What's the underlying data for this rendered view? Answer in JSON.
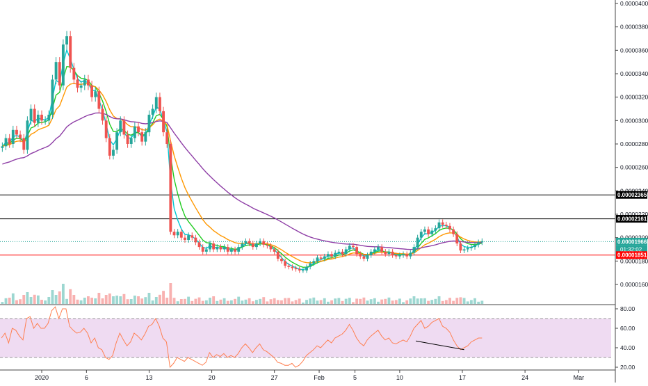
{
  "chart_data": [
    {
      "type": "candlestick",
      "title": "",
      "y_axis": {
        "position": "right",
        "range": [
          1.5e-05,
          4e-05
        ],
        "ticks": [
          "0.00001600",
          "0.00001800",
          "0.00002000",
          "0.00002200",
          "0.00002400",
          "0.00002600",
          "0.00002800",
          "0.00003000",
          "0.00003200",
          "0.00003400",
          "0.00003600",
          "0.00003800",
          "0.00004000"
        ]
      },
      "x_axis": {
        "ticks": [
          {
            "label": "2020",
            "day": 0
          },
          {
            "label": "6",
            "day": 5
          },
          {
            "label": "13",
            "day": 12
          },
          {
            "label": "20",
            "day": 19
          },
          {
            "label": "27",
            "day": 26
          },
          {
            "label": "Feb",
            "day": 31
          },
          {
            "label": "5",
            "day": 35
          },
          {
            "label": "10",
            "day": 40
          },
          {
            "label": "17",
            "day": 47
          },
          {
            "label": "24",
            "day": 54
          },
          {
            "label": "Mar",
            "day": 60
          }
        ],
        "start_day": -4.5,
        "end_day": 65
      },
      "price_lines": [
        {
          "label": "0.00002365",
          "value": 2.365e-05,
          "color": "#000000",
          "style": "solid"
        },
        {
          "label": "0.00002161",
          "value": 2.161e-05,
          "color": "#000000",
          "style": "solid"
        },
        {
          "label": "0.00001966",
          "value": 1.966e-05,
          "color": "#26a69a",
          "style": "dotted"
        },
        {
          "label": "0.00001851",
          "value": 1.851e-05,
          "color": "#ff0000",
          "style": "solid"
        }
      ],
      "countdown": "01:32:02",
      "series": [
        {
          "name": "price",
          "kind": "candles",
          "up_color": "#26a69a",
          "down_color": "#ef5350",
          "points": [
            [
              -4.4,
              2.78e-05
            ],
            [
              -4.0,
              2.85e-05
            ],
            [
              -3.6,
              2.8e-05
            ],
            [
              -3.2,
              2.92e-05
            ],
            [
              -2.8,
              2.88e-05
            ],
            [
              -2.4,
              2.85e-05
            ],
            [
              -2.0,
              2.75e-05
            ],
            [
              -1.6,
              3e-05
            ],
            [
              -1.2,
              3.1e-05
            ],
            [
              -0.8,
              2.98e-05
            ],
            [
              -0.4,
              3.05e-05
            ],
            [
              0.0,
              3e-05
            ],
            [
              0.4,
              3e-05
            ],
            [
              0.8,
              3.05e-05
            ],
            [
              1.2,
              3.35e-05
            ],
            [
              1.6,
              3.5e-05
            ],
            [
              2.0,
              3.3e-05
            ],
            [
              2.4,
              3.65e-05
            ],
            [
              2.8,
              3.72e-05
            ],
            [
              3.2,
              3.45e-05
            ],
            [
              3.6,
              3.35e-05
            ],
            [
              4.0,
              3.28e-05
            ],
            [
              4.4,
              3.3e-05
            ],
            [
              4.8,
              3.35e-05
            ],
            [
              5.2,
              3.3e-05
            ],
            [
              5.6,
              3.2e-05
            ],
            [
              6.0,
              3.25e-05
            ],
            [
              6.4,
              3.1e-05
            ],
            [
              6.8,
              3e-05
            ],
            [
              7.2,
              2.85e-05
            ],
            [
              7.6,
              2.7e-05
            ],
            [
              8.0,
              2.75e-05
            ],
            [
              8.4,
              2.9e-05
            ],
            [
              8.8,
              3e-05
            ],
            [
              9.2,
              2.88e-05
            ],
            [
              9.6,
              2.8e-05
            ],
            [
              10.0,
              2.85e-05
            ],
            [
              10.4,
              2.95e-05
            ],
            [
              10.8,
              2.9e-05
            ],
            [
              11.2,
              2.82e-05
            ],
            [
              11.6,
              2.9e-05
            ],
            [
              12.0,
              3.05e-05
            ],
            [
              12.4,
              3.1e-05
            ],
            [
              12.8,
              3.2e-05
            ],
            [
              13.2,
              3.08e-05
            ],
            [
              13.6,
              2.9e-05
            ],
            [
              14.0,
              2.8e-05
            ],
            [
              14.4,
              2.05e-05
            ],
            [
              14.8,
              2.02e-05
            ],
            [
              15.2,
              2.05e-05
            ],
            [
              15.6,
              2e-05
            ],
            [
              16.0,
              1.98e-05
            ],
            [
              16.4,
              2.02e-05
            ],
            [
              16.8,
              2e-05
            ],
            [
              17.2,
              1.96e-05
            ],
            [
              17.6,
              1.92e-05
            ],
            [
              18.0,
              1.88e-05
            ],
            [
              18.4,
              1.9e-05
            ],
            [
              18.8,
              1.95e-05
            ],
            [
              19.2,
              1.9e-05
            ],
            [
              19.6,
              1.92e-05
            ],
            [
              20.0,
              1.9e-05
            ],
            [
              20.4,
              1.92e-05
            ],
            [
              20.8,
              1.88e-05
            ],
            [
              21.2,
              1.9e-05
            ],
            [
              21.6,
              1.88e-05
            ],
            [
              22.0,
              1.92e-05
            ],
            [
              22.4,
              1.95e-05
            ],
            [
              22.8,
              1.97e-05
            ],
            [
              23.2,
              1.95e-05
            ],
            [
              23.6,
              1.92e-05
            ],
            [
              24.0,
              1.95e-05
            ],
            [
              24.4,
              1.97e-05
            ],
            [
              24.8,
              1.94e-05
            ],
            [
              25.2,
              1.93e-05
            ],
            [
              25.6,
              1.9e-05
            ],
            [
              26.0,
              1.88e-05
            ],
            [
              26.4,
              1.82e-05
            ],
            [
              26.8,
              1.8e-05
            ],
            [
              27.2,
              1.76e-05
            ],
            [
              27.6,
              1.75e-05
            ],
            [
              28.0,
              1.74e-05
            ],
            [
              28.4,
              1.73e-05
            ],
            [
              28.8,
              1.72e-05
            ],
            [
              29.2,
              1.72e-05
            ],
            [
              29.6,
              1.75e-05
            ],
            [
              30.0,
              1.78e-05
            ],
            [
              30.4,
              1.8e-05
            ],
            [
              30.8,
              1.83e-05
            ],
            [
              31.2,
              1.82e-05
            ],
            [
              31.6,
              1.84e-05
            ],
            [
              32.0,
              1.86e-05
            ],
            [
              32.4,
              1.84e-05
            ],
            [
              32.8,
              1.87e-05
            ],
            [
              33.2,
              1.88e-05
            ],
            [
              33.6,
              1.86e-05
            ],
            [
              34.0,
              1.9e-05
            ],
            [
              34.4,
              1.93e-05
            ],
            [
              34.8,
              1.92e-05
            ],
            [
              35.2,
              1.86e-05
            ],
            [
              35.6,
              1.84e-05
            ],
            [
              36.0,
              1.82e-05
            ],
            [
              36.4,
              1.85e-05
            ],
            [
              36.8,
              1.88e-05
            ],
            [
              37.2,
              1.9e-05
            ],
            [
              37.6,
              1.92e-05
            ],
            [
              38.0,
              1.88e-05
            ],
            [
              38.4,
              1.86e-05
            ],
            [
              38.8,
              1.88e-05
            ],
            [
              39.2,
              1.85e-05
            ],
            [
              39.6,
              1.84e-05
            ],
            [
              40.0,
              1.85e-05
            ],
            [
              40.4,
              1.86e-05
            ],
            [
              40.8,
              1.84e-05
            ],
            [
              41.2,
              1.87e-05
            ],
            [
              41.6,
              1.92e-05
            ],
            [
              42.0,
              2e-05
            ],
            [
              42.4,
              2.05e-05
            ],
            [
              42.8,
              2.07e-05
            ],
            [
              43.2,
              2.03e-05
            ],
            [
              43.6,
              2.06e-05
            ],
            [
              44.0,
              2.08e-05
            ],
            [
              44.4,
              2.13e-05
            ],
            [
              44.8,
              2.11e-05
            ],
            [
              45.2,
              2.1e-05
            ],
            [
              45.6,
              2.07e-05
            ],
            [
              46.0,
              2.03e-05
            ],
            [
              46.4,
              1.95e-05
            ],
            [
              46.8,
              1.89e-05
            ],
            [
              47.2,
              1.9e-05
            ],
            [
              47.6,
              1.91e-05
            ],
            [
              48.0,
              1.92e-05
            ],
            [
              48.4,
              1.94e-05
            ],
            [
              48.8,
              1.96e-05
            ],
            [
              49.2,
              1.97e-05
            ]
          ]
        },
        {
          "name": "ema-fast",
          "kind": "line",
          "color": "#00c8d2"
        },
        {
          "name": "ema-mid",
          "kind": "line",
          "color": "#22cc22"
        },
        {
          "name": "ema-slow",
          "kind": "line",
          "color": "#ff9800"
        },
        {
          "name": "sma-long",
          "kind": "line",
          "color": "#8e3ea6"
        }
      ]
    },
    {
      "type": "line",
      "title": "",
      "name": "rsi",
      "y_axis": {
        "position": "right",
        "range": [
          15,
          85
        ],
        "ticks": [
          "20.00",
          "40.00",
          "60.00",
          "80.00"
        ]
      },
      "bands": {
        "upper": 70,
        "lower": 30,
        "fill": "#e1bee7"
      },
      "line_color": "#ff7f50",
      "values": [
        50,
        55,
        45,
        60,
        58,
        52,
        48,
        70,
        72,
        60,
        65,
        60,
        60,
        65,
        78,
        82,
        70,
        80,
        80,
        62,
        58,
        55,
        56,
        60,
        55,
        45,
        50,
        40,
        38,
        30,
        28,
        32,
        45,
        55,
        48,
        42,
        46,
        55,
        52,
        48,
        54,
        62,
        64,
        70,
        62,
        50,
        46,
        20,
        24,
        30,
        28,
        26,
        30,
        28,
        26,
        24,
        22,
        25,
        35,
        30,
        33,
        31,
        34,
        30,
        32,
        30,
        34,
        40,
        44,
        40,
        35,
        40,
        44,
        38,
        36,
        33,
        30,
        25,
        24,
        22,
        22,
        24,
        20,
        22,
        26,
        32,
        35,
        38,
        42,
        40,
        44,
        48,
        45,
        50,
        52,
        54,
        58,
        64,
        58,
        50,
        45,
        42,
        48,
        52,
        55,
        58,
        52,
        48,
        50,
        45,
        44,
        46,
        48,
        46,
        52,
        60,
        64,
        68,
        60,
        62,
        66,
        68,
        70,
        62,
        60,
        56,
        48,
        42,
        38,
        40,
        42,
        46,
        48,
        50,
        50
      ],
      "annotation": {
        "kind": "trendline",
        "from": {
          "day": 41.8,
          "value": 47
        },
        "to": {
          "day": 47.2,
          "value": 38
        }
      }
    }
  ]
}
